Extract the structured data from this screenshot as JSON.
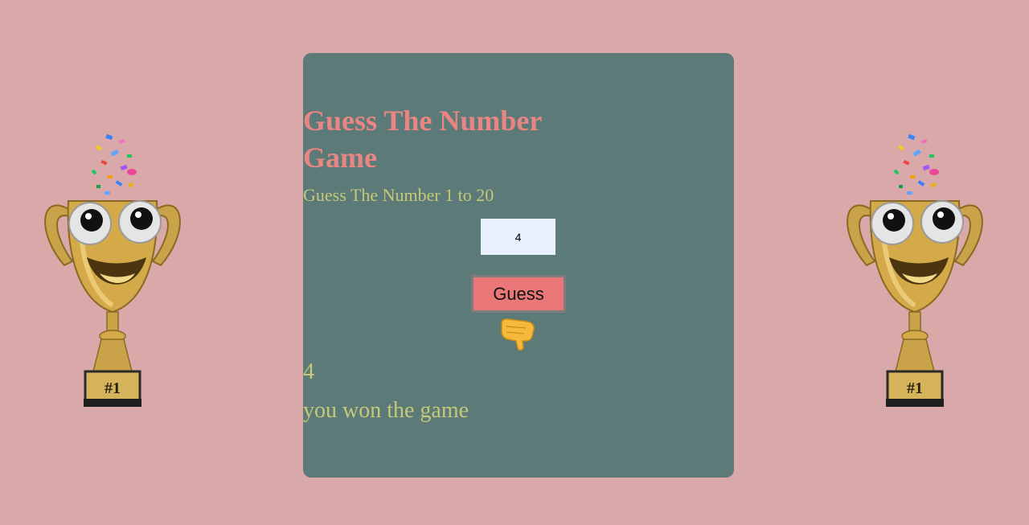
{
  "game": {
    "title": "Guess The Number Game",
    "instruction": "Guess The Number 1 to 20",
    "input_value": "4",
    "guess_button_label": "Guess",
    "result_number": "4",
    "result_message": "you won the game"
  },
  "decorations": {
    "left_trophy_label": "#1",
    "right_trophy_label": "#1",
    "pointer_icon": "backhand-index-pointing-down"
  },
  "colors": {
    "background": "#d9a9a9",
    "card": "#5b7a78",
    "title": "#e98582",
    "text": "#c6c87a",
    "button": "#e97777",
    "input": "#e8f0fe"
  }
}
